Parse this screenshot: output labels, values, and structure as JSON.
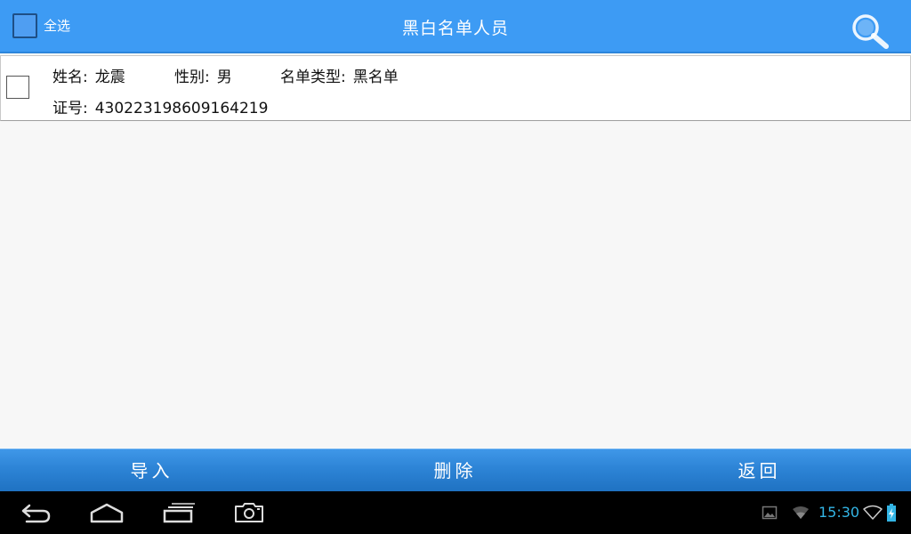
{
  "header": {
    "select_all_label": "全选",
    "title": "黑白名单人员",
    "search_icon": "search-icon"
  },
  "list": {
    "items": [
      {
        "name_label": "姓名:",
        "name_value": "龙震",
        "gender_label": "性别:",
        "gender_value": "男",
        "type_label": "名单类型:",
        "type_value": "黑名单",
        "id_label": "证号:",
        "id_value": "430223198609164219"
      }
    ]
  },
  "actions": {
    "import_label": "导入",
    "delete_label": "删除",
    "back_label": "返回"
  },
  "status_bar": {
    "time": "15:30",
    "time_color": "#33b5e5"
  },
  "colors": {
    "accent": "#3d9bf4",
    "action_bar": "#2d84d6"
  }
}
